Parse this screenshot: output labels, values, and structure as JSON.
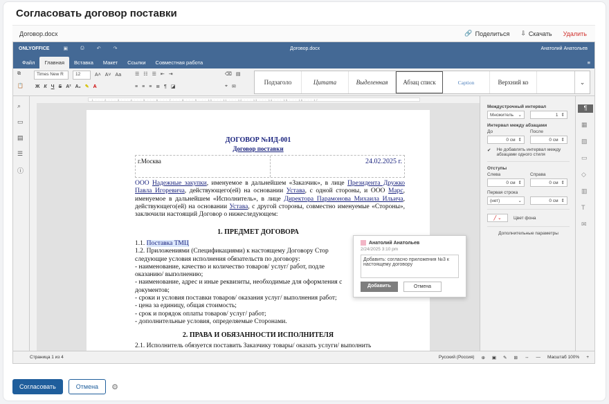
{
  "page_title": "Согласовать договор поставки",
  "file_header": {
    "filename": "Договор.docx",
    "share_label": "Поделиться",
    "download_label": "Скачать",
    "delete_label": "Удалить"
  },
  "editor": {
    "logo": "ONLYOFFICE",
    "doc_title": "Договор.docx",
    "user": "Анатолий Анатольев",
    "tabs": [
      "Файл",
      "Главная",
      "Вставка",
      "Макет",
      "Ссылки",
      "Совместная работа"
    ],
    "font_name": "Times New R",
    "font_size": "12",
    "styles": [
      "Подзаголо",
      "Цитата",
      "Выделенная",
      "Абзац списк",
      "Caption",
      "Верхний ко"
    ],
    "document": {
      "title": "ДОГОВОР №ИД-001",
      "subtitle": "Договор поставки",
      "city": "г.Москва",
      "date": "24.02.2025 г.",
      "party_a_org": "ООО",
      "party_a_name": "Надежные закупки",
      "party_a_role": ", именуемое в дальнейшем «Заказчик», в лице",
      "party_a_signer": "Президента Дружко Павла Игоревича",
      "party_a_basis": ", действующего(ей) на основании",
      "charter": "Устава",
      "party_b_lead": ", с одной стороны, и ООО",
      "party_b_name": "Марс",
      "party_b_role": ", именуемое в дальнейшем «Исполнитель», в лице",
      "party_b_signer": "Директора Парамонова Михаила Ильича",
      "party_b_tail": ", с другой стороны, совместно именуемые «Стороны», заключили настоящий Договор о нижеследующем:",
      "section1": "1.  ПРЕДМЕТ ДОГОВОРА",
      "item_1_1_num": "1.1.",
      "item_1_1_text": "Поставка ТМЦ",
      "item_1_2": "1.2. Приложениями (Спецификациями) к настоящему Договору Стор",
      "item_1_2b": "следующие условия исполнения обязательств по договору:",
      "bullet1": "- наименование, качество и количество товаров/ услуг/ работ, подле",
      "bullet1b": "оказанию/ выполнению;",
      "bullet2": "- наименование, адрес и иные реквизиты, необходимые для оформления с",
      "bullet2b": "документов;",
      "bullet3": "- сроки и условия поставки товаров/ оказания услуг/ выполнения работ;",
      "bullet4": "- цена за единицу, общая стоимость;",
      "bullet5": "- срок и порядок оплаты товаров/ услуг/ работ;",
      "bullet6": "- дополнительные условия, определяемые Сторонами.",
      "section2": "2.  ПРАВА И ОБЯЗАННОСТИ ИСПОЛНИТЕЛЯ",
      "item_2_1": "2.1.     Исполнитель обязуется поставить Заказчику товары/ оказать услуги/ выполнить"
    },
    "comment": {
      "author": "Анатолий Анатольев",
      "date": "2/24/2025 3:10 pm",
      "text": "Добавить: согласно приложения №3 к настоящему договору",
      "add_label": "Добавить",
      "cancel_label": "Отмена"
    },
    "paragraph_panel": {
      "line_spacing_label": "Междустрочный интервал",
      "line_spacing_type": "Множитель",
      "line_spacing_value": "1",
      "para_spacing_label": "Интервал между абзацами",
      "before_label": "До",
      "after_label": "После",
      "before_value": "0 см",
      "after_value": "0 см",
      "no_interval_label": "Не добавлять интервал между абзацами одного стиля",
      "indents_label": "Отступы",
      "left_label": "Слева",
      "right_label": "Справа",
      "left_value": "0 см",
      "right_value": "0 см",
      "first_line_label": "Первая строка",
      "first_line_type": "(нет)",
      "first_line_value": "0 см",
      "bg_color_label": "Цвет фона",
      "more_label": "Дополнительные параметры"
    },
    "status": {
      "page": "Страница 1 из 4",
      "language": "Русский (Россия)",
      "zoom": "Масштаб 100%"
    }
  },
  "footer": {
    "approve_label": "Согласовать",
    "cancel_label": "Отмена"
  }
}
